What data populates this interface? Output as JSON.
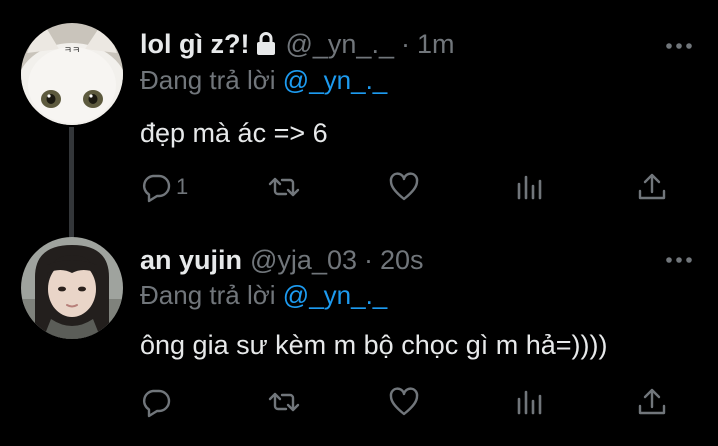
{
  "tweets": [
    {
      "display_name": "lol gì z?!",
      "handle": "@_yn_._",
      "separator": "·",
      "time": "1m",
      "replying_prefix": "Đang trả lời",
      "replying_to": "@_yn_._",
      "text": "đẹp mà ác => 6",
      "reply_count": "1",
      "protected": true,
      "avatar": "white-cat-avatar",
      "avatar_text": "ㅋㅋ"
    },
    {
      "display_name": "an yujin",
      "handle": "@yja_03",
      "separator": "·",
      "time": "20s",
      "replying_prefix": "Đang trả lời",
      "replying_to": "@_yn_._",
      "text": "ông gia sư kèm m bộ chọc gì m hả=))))",
      "reply_count": "",
      "protected": false,
      "avatar": "girl-portrait-avatar"
    }
  ],
  "icons": {
    "reply": "reply-icon",
    "retweet": "retweet-icon",
    "like": "heart-icon",
    "views": "views-icon",
    "share": "share-icon",
    "more": "more-icon",
    "lock": "lock-icon"
  },
  "colors": {
    "background": "#000000",
    "primary_text": "#e7e9ea",
    "secondary_text": "#71767b",
    "link": "#1d9bf0",
    "thread_line": "#333639"
  }
}
